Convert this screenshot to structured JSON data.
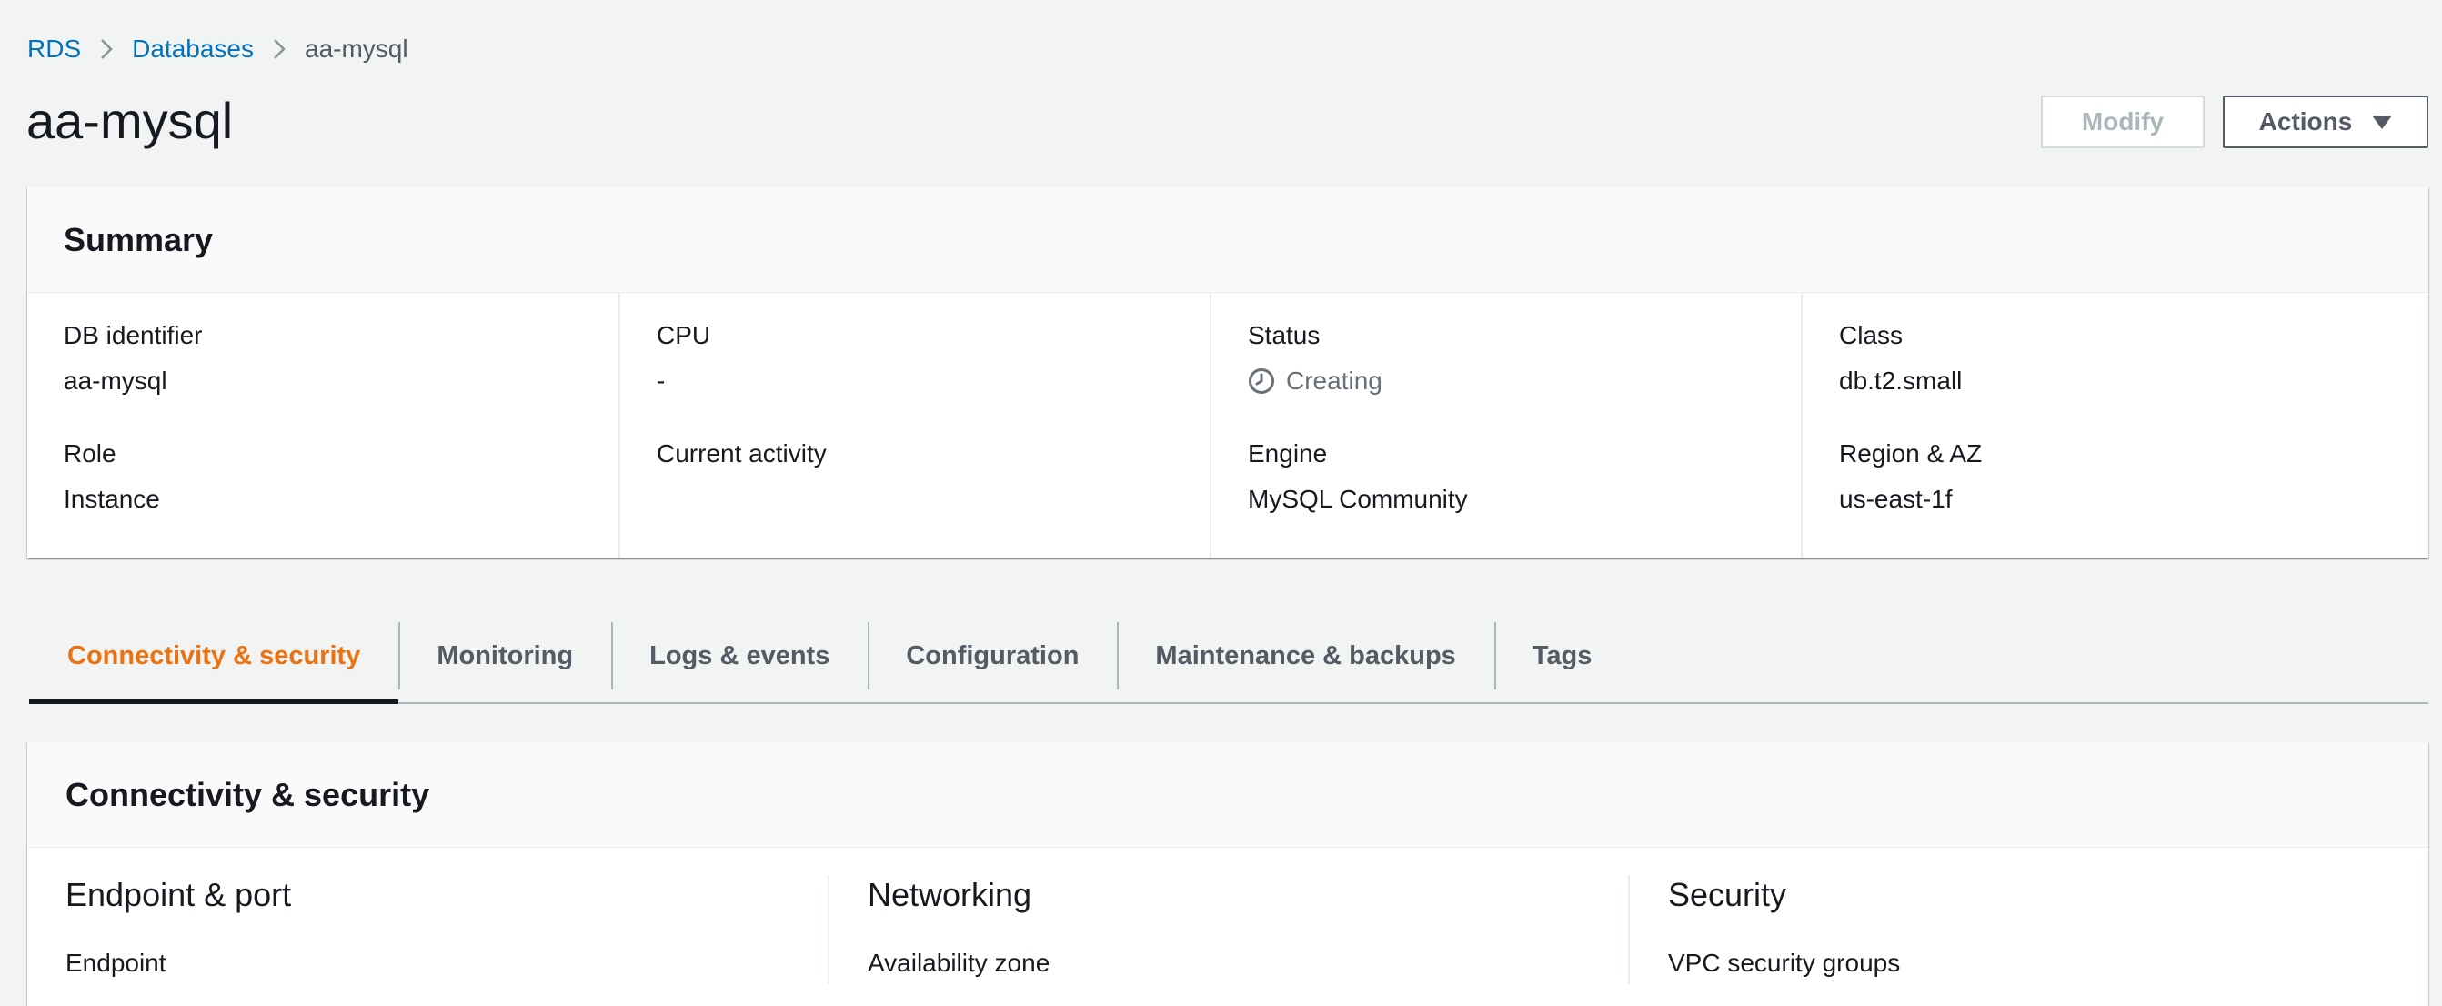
{
  "breadcrumb": {
    "items": [
      "RDS",
      "Databases"
    ],
    "current": "aa-mysql"
  },
  "header": {
    "title": "aa-mysql",
    "modify_label": "Modify",
    "actions_label": "Actions"
  },
  "summary": {
    "title": "Summary",
    "db_identifier_label": "DB identifier",
    "db_identifier_value": "aa-mysql",
    "role_label": "Role",
    "role_value": "Instance",
    "cpu_label": "CPU",
    "cpu_value": "-",
    "current_activity_label": "Current activity",
    "status_label": "Status",
    "status_value": "Creating",
    "engine_label": "Engine",
    "engine_value": "MySQL Community",
    "class_label": "Class",
    "class_value": "db.t2.small",
    "region_label": "Region & AZ",
    "region_value": "us-east-1f"
  },
  "tabs": [
    {
      "label": "Connectivity & security",
      "active": true
    },
    {
      "label": "Monitoring",
      "active": false
    },
    {
      "label": "Logs & events",
      "active": false
    },
    {
      "label": "Configuration",
      "active": false
    },
    {
      "label": "Maintenance & backups",
      "active": false
    },
    {
      "label": "Tags",
      "active": false
    }
  ],
  "connectivity": {
    "title": "Connectivity & security",
    "endpoint_heading": "Endpoint & port",
    "endpoint_label": "Endpoint",
    "networking_heading": "Networking",
    "az_label": "Availability zone",
    "security_heading": "Security",
    "vpc_sg_label": "VPC security groups"
  },
  "colors": {
    "link": "#0073bb",
    "active_tab": "#ec7211",
    "background": "#f2f3f3"
  },
  "icons": {
    "breadcrumb_separator": "chevron-right-icon",
    "actions_caret": "caret-down-icon",
    "status": "clock-icon"
  }
}
